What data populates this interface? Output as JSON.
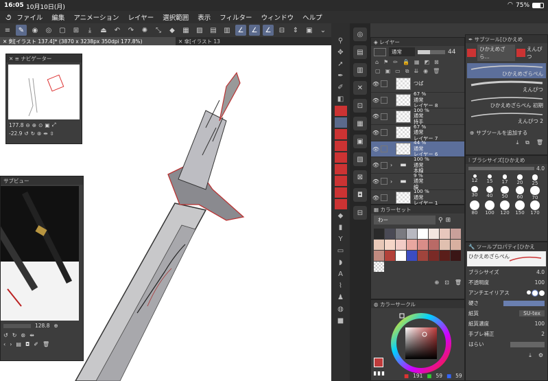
{
  "status": {
    "time": "16:05",
    "date": "10月10日(月)",
    "battery": "75%"
  },
  "menu": [
    "ファイル",
    "編集",
    "アニメーション",
    "レイヤー",
    "選択範囲",
    "表示",
    "フィルター",
    "ウィンドウ",
    "ヘルプ"
  ],
  "tabs": {
    "active": "剣[イラスト 137.4]* (3870 x 3238px 350dpi 177.8%)",
    "inactive": "傘[イラスト 13"
  },
  "navigator": {
    "title": "ナビゲーター",
    "zoom": "177.8",
    "rotation": "-22.9"
  },
  "subview": {
    "title": "サブビュー",
    "zoom": "128.8"
  },
  "layer_panel": {
    "title": "レイヤー",
    "blend": "通常",
    "opacity": "44",
    "layers": [
      {
        "name": "つば",
        "opacity": "",
        "mode": "",
        "folder": false,
        "selected": false
      },
      {
        "name": "レイヤー 8",
        "opacity": "67 %",
        "mode": "通常",
        "folder": false,
        "selected": false
      },
      {
        "name": "持手",
        "opacity": "100 %",
        "mode": "通常",
        "folder": false,
        "selected": false
      },
      {
        "name": "レイヤー 7",
        "opacity": "67 %",
        "mode": "通常",
        "folder": false,
        "selected": false
      },
      {
        "name": "レイヤー 6",
        "opacity": "44 %",
        "mode": "通常",
        "folder": false,
        "selected": true
      },
      {
        "name": "本線",
        "opacity": "100 %",
        "mode": "通常",
        "folder": true,
        "selected": false
      },
      {
        "name": "線",
        "opacity": "9 %",
        "mode": "通常",
        "folder": true,
        "selected": false
      },
      {
        "name": "レイヤー 1",
        "opacity": "100 %",
        "mode": "通常",
        "folder": false,
        "selected": false
      }
    ]
  },
  "color_set": {
    "title": "カラーセット",
    "set_name": "わー",
    "colors": [
      "#2a2a2a",
      "#4a4a55",
      "#7a7a80",
      "#b8b8c0",
      "#ffffff",
      "#f3e6e0",
      "#e7c7bd",
      "#c9a09a",
      "#e8c8b8",
      "#f5d6c8",
      "#f2ccc6",
      "#e9a7a0",
      "#d98d88",
      "#b96a66",
      "#e0c0b0",
      "#d8b0a0",
      "#c08a80",
      "#b3413a",
      "#ffffff",
      "#3b4cc2",
      "#a0443c",
      "#7a2a26",
      "#5a1e1a",
      "#3a1616"
    ]
  },
  "color_circle": {
    "title": "カラーサークル",
    "r": "191",
    "g": "59",
    "b": "59",
    "main_color": "#bf3b3b"
  },
  "subtool": {
    "title": "サブツール[ひかえめ",
    "active_tab": "ひかえめざら...",
    "tab2": "えんぴつ",
    "items": [
      {
        "label": "ひかえめざらぺん",
        "selected": true
      },
      {
        "label": "えんぴつ",
        "selected": false
      },
      {
        "label": "ひかえめざらぺん 初期",
        "selected": false
      },
      {
        "label": "えんぴつ 2",
        "selected": false
      }
    ],
    "add_label": "サブツールを追加する"
  },
  "brush_size": {
    "title": "ブラシサイズ[ひかえめ",
    "value": "4.0",
    "sizes": [
      "12",
      "15",
      "17",
      "20",
      "25",
      "30",
      "40",
      "50",
      "60",
      "70",
      "80",
      "100",
      "120",
      "150",
      "170"
    ]
  },
  "tool_property": {
    "title": "ツールプロパティ[ひかえ",
    "tool_name": "ひかえめざらぺん",
    "brush_size_label": "ブラシサイズ",
    "brush_size_value": "4.0",
    "opacity_label": "不透明度",
    "opacity_value": "100",
    "antialias_label": "アンチエイリアス",
    "hardness_label": "硬さ",
    "paper_label": "紙質",
    "paper_value": "SU-tex",
    "paper_density_label": "紙質濃度",
    "paper_density_value": "100",
    "stabilization_label": "手ブレ補正",
    "stabilization_value": "2",
    "sweep_label": "はらい"
  }
}
